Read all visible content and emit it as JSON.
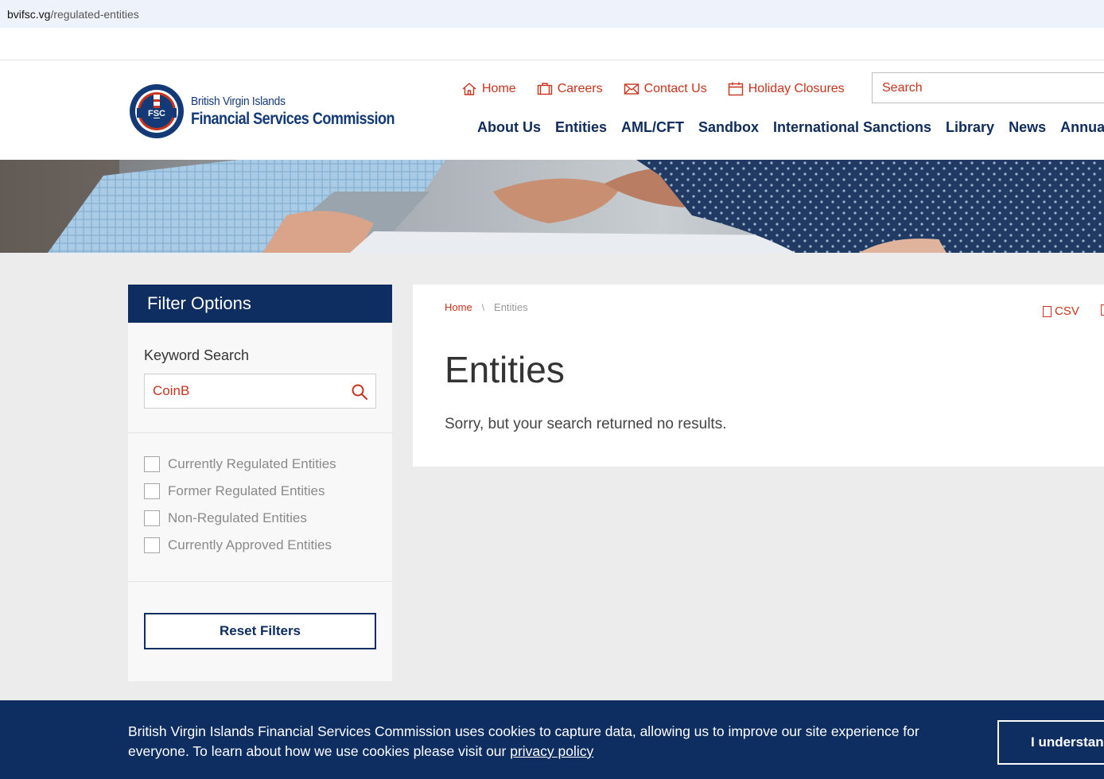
{
  "browser": {
    "url_host": "bvifsc.vg",
    "url_path": "/regulated-entities"
  },
  "logo": {
    "line1": "British Virgin Islands",
    "line2": "Financial Services Commission",
    "seal_text": "FSC"
  },
  "utility_nav": [
    {
      "label": "Home",
      "icon": "house-icon"
    },
    {
      "label": "Careers",
      "icon": "briefcase-icon"
    },
    {
      "label": "Contact Us",
      "icon": "envelope-icon"
    },
    {
      "label": "Holiday Closures",
      "icon": "calendar-icon"
    }
  ],
  "search": {
    "placeholder": "Search"
  },
  "main_nav": [
    "About Us",
    "Entities",
    "AML/CFT",
    "Sandbox",
    "International Sanctions",
    "Library",
    "News",
    "Annual R"
  ],
  "sidebar": {
    "title": "Filter Options",
    "keyword_label": "Keyword Search",
    "keyword_value": "CoinB",
    "filters": [
      "Currently Regulated Entities",
      "Former Regulated Entities",
      "Non-Regulated Entities",
      "Currently Approved Entities"
    ],
    "reset_label": "Reset Filters"
  },
  "content": {
    "breadcrumb": {
      "home": "Home",
      "separator": "\\",
      "current": "Entities"
    },
    "csv_label": "CSV",
    "title": "Entities",
    "message": "Sorry, but your search returned no results."
  },
  "cookie": {
    "text": "British Virgin Islands Financial Services Commission uses cookies to capture data, allowing us to improve our site experience for everyone. To learn about how we use cookies please visit our ",
    "link": "privacy policy",
    "button": "I understand"
  },
  "colors": {
    "navy": "#0e2d61",
    "accent_red": "#c8331d",
    "page_bg": "#ececec"
  }
}
